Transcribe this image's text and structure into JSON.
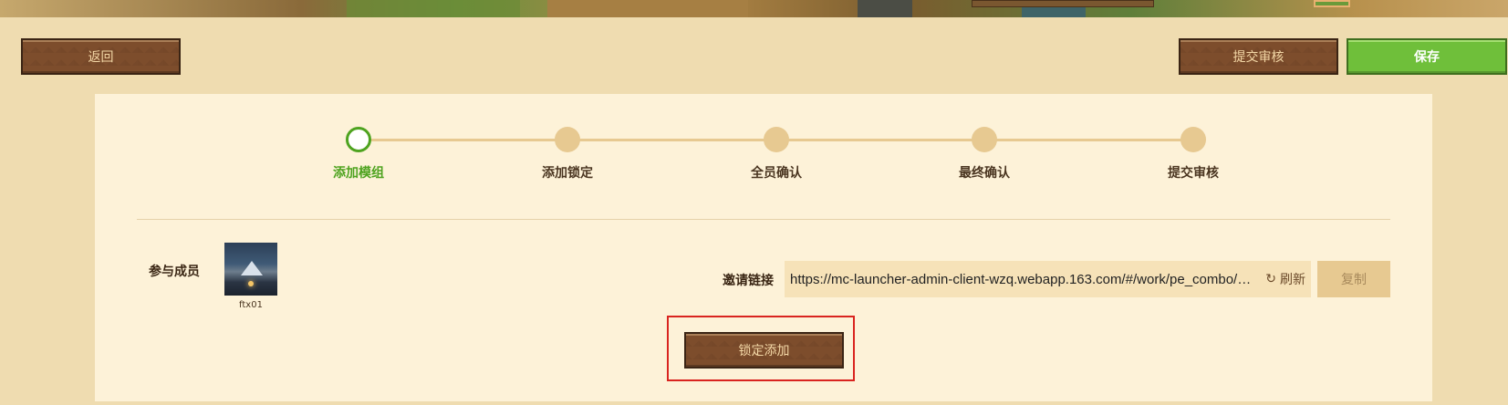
{
  "header": {
    "back_label": "返回",
    "submit_label": "提交审核",
    "save_label": "保存"
  },
  "steps": [
    {
      "label": "添加模组",
      "active": true
    },
    {
      "label": "添加锁定",
      "active": false
    },
    {
      "label": "全员确认",
      "active": false
    },
    {
      "label": "最终确认",
      "active": false
    },
    {
      "label": "提交审核",
      "active": false
    }
  ],
  "members": {
    "label": "参与成员",
    "list": [
      {
        "name": "ftx01"
      }
    ]
  },
  "invite": {
    "label": "邀请链接",
    "link": "https://mc-launcher-admin-client-wzq.webapp.163.com/#/work/pe_combo/edit/46…",
    "refresh_label": "刷新",
    "copy_label": "复制"
  },
  "actions": {
    "lock_add_label": "锁定添加"
  },
  "colors": {
    "accent_green": "#4ea31f",
    "button_brown": "#7d4d2c",
    "highlight_red": "#d9241f",
    "panel_bg": "#fdf2d8"
  },
  "icons": {
    "refresh": "refresh-icon"
  }
}
